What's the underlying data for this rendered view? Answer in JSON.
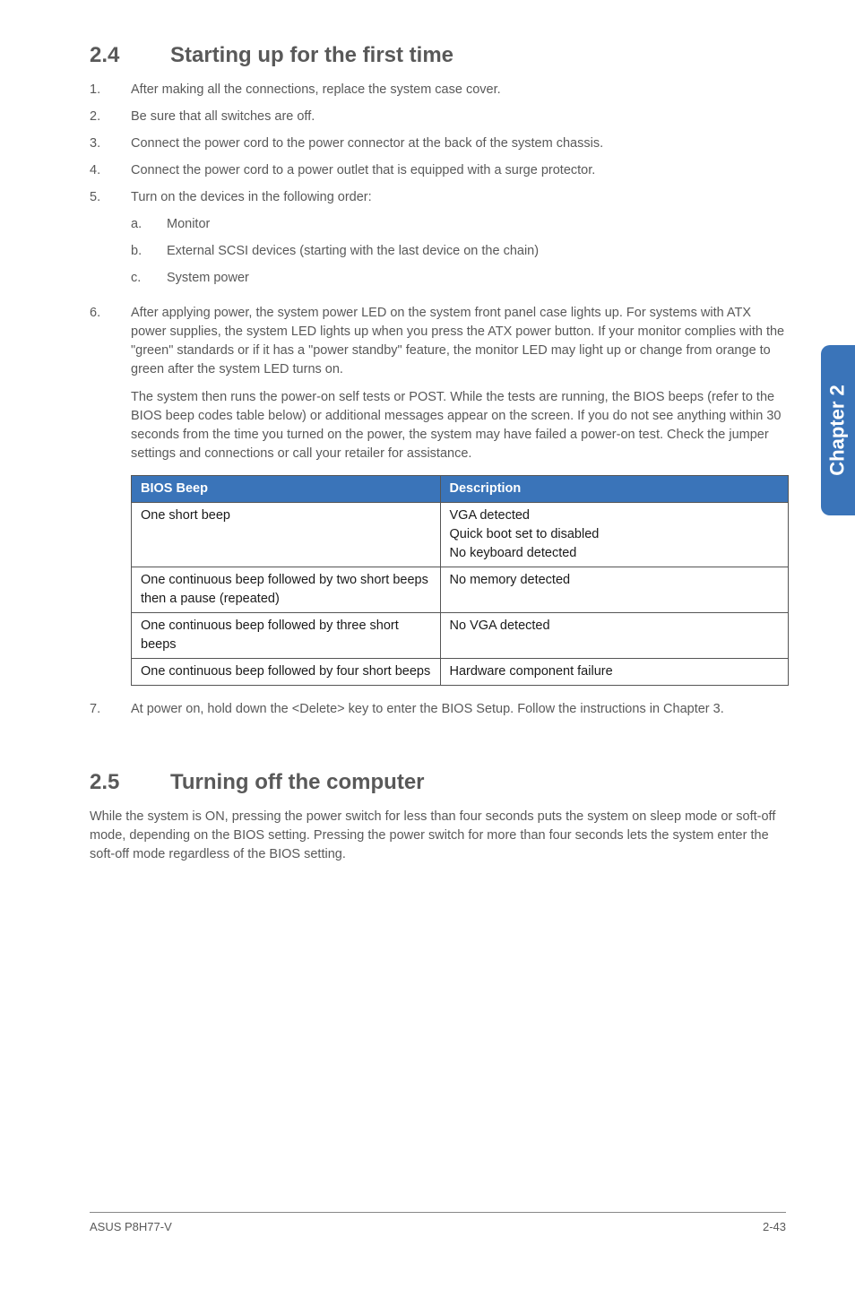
{
  "side_tab": "Chapter 2",
  "section24": {
    "num": "2.4",
    "title": "Starting up for the first time",
    "items": {
      "n1": "1.",
      "t1": "After making all the connections, replace the system case cover.",
      "n2": "2.",
      "t2": "Be sure that all switches are off.",
      "n3": "3.",
      "t3": "Connect the power cord to the power connector at the back of the system chassis.",
      "n4": "4.",
      "t4": "Connect the power cord to a power outlet that is equipped with a surge protector.",
      "n5": "5.",
      "t5": "Turn on the devices in the following order:",
      "s5a_l": "a.",
      "s5a": "Monitor",
      "s5b_l": "b.",
      "s5b": "External SCSI devices (starting with the last device on the chain)",
      "s5c_l": "c.",
      "s5c": "System power",
      "n6": "6.",
      "t6": "After applying power, the system power LED on the system front panel case lights up. For systems with ATX power supplies, the system LED lights up when you press the ATX power button. If your monitor complies with the \"green\" standards or if it has a \"power standby\" feature, the monitor LED may light up or change from orange to green after the system LED turns on.",
      "t6b": "The system then runs the power-on self tests or POST. While the tests are running, the BIOS beeps (refer to the BIOS beep codes table below) or additional messages appear on the screen. If you do not see anything within 30 seconds from the time you turned on the power, the system may have failed a power-on test. Check the jumper settings and connections or call your retailer for assistance.",
      "n7": "7.",
      "t7": "At power on, hold down the <Delete> key to enter the BIOS Setup. Follow the instructions in Chapter 3."
    },
    "table": {
      "h1": "BIOS Beep",
      "h2": "Description",
      "r1c1": "One short beep",
      "r1c2_l1": "VGA detected",
      "r1c2_l2": "Quick boot set to disabled",
      "r1c2_l3": "No keyboard detected",
      "r2c1": "One continuous beep followed by two short beeps then a pause (repeated)",
      "r2c2": "No memory detected",
      "r3c1": "One continuous beep followed by three short beeps",
      "r3c2": "No VGA detected",
      "r4c1": "One continuous beep followed by four short beeps",
      "r4c2": "Hardware component failure"
    }
  },
  "section25": {
    "num": "2.5",
    "title": "Turning off the computer",
    "body": "While the system is ON, pressing the power switch for less than four seconds puts the system on sleep mode or soft-off mode, depending on the BIOS setting. Pressing the power switch for more than four seconds lets the system enter the soft-off mode regardless of the BIOS setting."
  },
  "footer": {
    "left": "ASUS P8H77-V",
    "right": "2-43"
  }
}
